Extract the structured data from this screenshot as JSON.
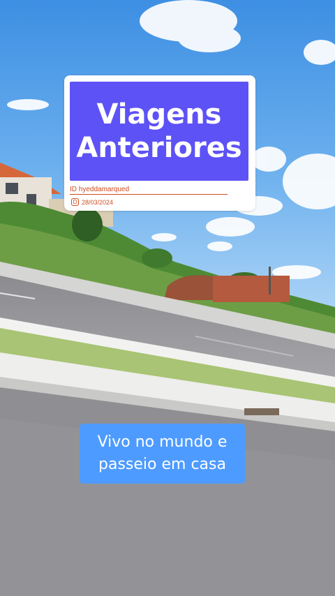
{
  "title_card": {
    "line1": "Viagens",
    "line2": "Anteriores",
    "id_text": "ID  hyeddamarqued",
    "date_icon": "D",
    "date": "28/03/2024"
  },
  "caption": {
    "line1": "Vivo no mundo e",
    "line2": "passeio em casa"
  },
  "colors": {
    "title_bg": "#5d52f6",
    "caption_bg": "#4e9bff",
    "accent": "#d14a1f"
  }
}
